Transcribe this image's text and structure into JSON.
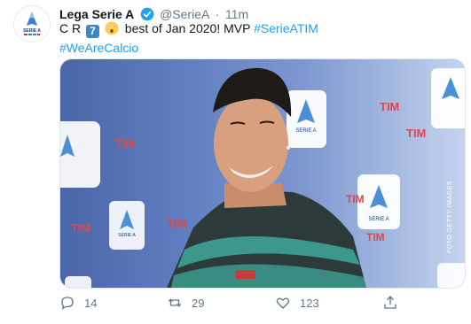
{
  "tweet": {
    "author": {
      "display_name": "Lega Serie A",
      "handle": "@SerieA",
      "time": "11m",
      "separator": "·",
      "avatar_text": "SERIE A"
    },
    "text": {
      "prefix": "C R",
      "keycap": "7",
      "body": "best of Jan 2020! MVP",
      "hashtag1": "#SerieATIM",
      "hashtag2": "#WeAreCalcio"
    },
    "media": {
      "credit": "FOTO GETTY IMAGES",
      "board_brand": "SERIE A",
      "board_sponsor": "TIM"
    },
    "actions": {
      "reply_count": "14",
      "retweet_count": "29",
      "like_count": "123"
    },
    "colors": {
      "link": "#1da1f2",
      "verified": "#1da1f2",
      "muted": "#657786"
    }
  }
}
